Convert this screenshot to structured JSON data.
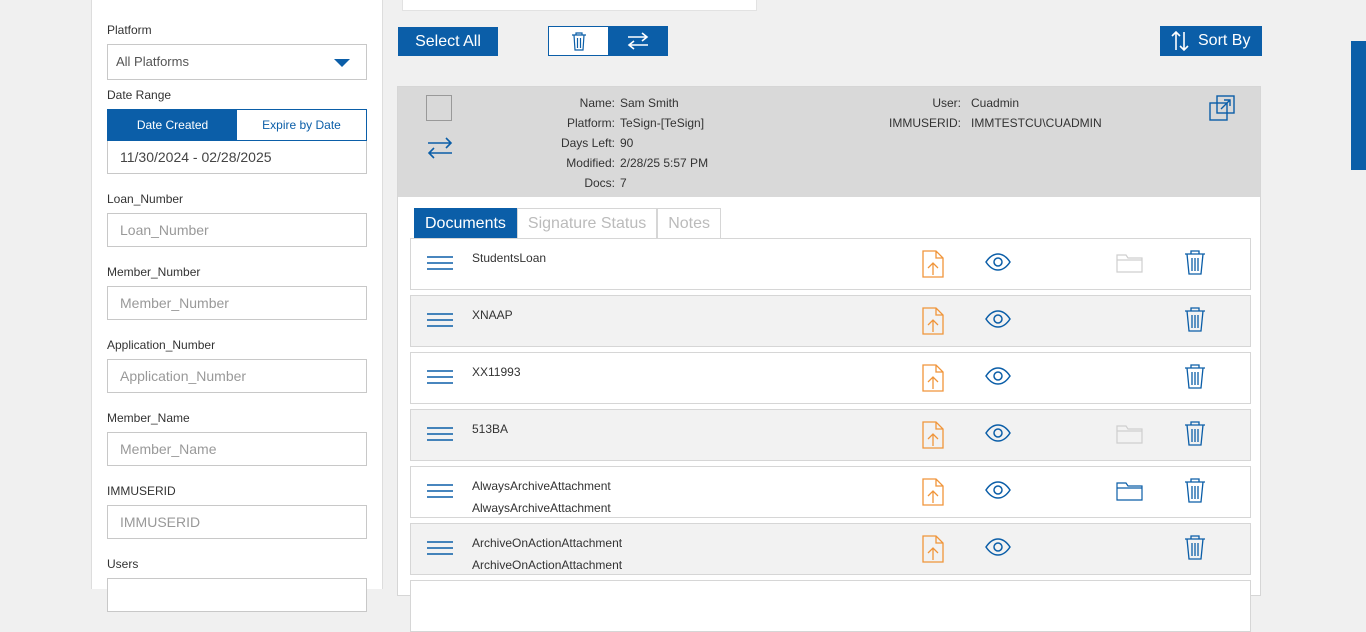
{
  "filters": {
    "platform_label": "Platform",
    "platform_value": "All Platforms",
    "date_range_label": "Date Range",
    "date_created": "Date Created",
    "expire_by_date": "Expire by Date",
    "date_value": "11/30/2024 - 02/28/2025",
    "loan_number_label": "Loan_Number",
    "loan_number_placeholder": "Loan_Number",
    "member_number_label": "Member_Number",
    "member_number_placeholder": "Member_Number",
    "application_number_label": "Application_Number",
    "application_number_placeholder": "Application_Number",
    "member_name_label": "Member_Name",
    "member_name_placeholder": "Member_Name",
    "immuserid_label": "IMMUSERID",
    "immuserid_placeholder": "IMMUSERID",
    "users_label": "Users"
  },
  "toolbar": {
    "select_all": "Select All",
    "sort_by": "Sort By"
  },
  "package": {
    "name_label": "Name:",
    "name": "Sam Smith",
    "platform_label": "Platform:",
    "platform": "TeSign-[TeSign]",
    "days_left_label": "Days Left:",
    "days_left": "90",
    "modified_label": "Modified:",
    "modified": "2/28/25 5:57 PM",
    "docs_label": "Docs:",
    "docs": "7",
    "user_label": "User:",
    "user": "Cuadmin",
    "immuserid_label": "IMMUSERID:",
    "immuserid": "IMMTESTCU\\CUADMIN"
  },
  "tabs": {
    "documents": "Documents",
    "signature_status": "Signature Status",
    "notes": "Notes"
  },
  "documents": [
    {
      "line1": "StudentsLoan",
      "line2": "",
      "folder": "faded"
    },
    {
      "line1": "XNAAP",
      "line2": "",
      "folder": "none"
    },
    {
      "line1": "XX11993",
      "line2": "",
      "folder": "none"
    },
    {
      "line1": "513BA",
      "line2": "",
      "folder": "faded"
    },
    {
      "line1": "AlwaysArchiveAttachment",
      "line2": "AlwaysArchiveAttachment",
      "folder": "active"
    },
    {
      "line1": "ArchiveOnActionAttachment",
      "line2": "ArchiveOnActionAttachment",
      "folder": "none"
    }
  ],
  "colors": {
    "primary": "#0b5ea8",
    "upload_icon": "#f0953a",
    "header_bg": "#d9d9d9"
  }
}
